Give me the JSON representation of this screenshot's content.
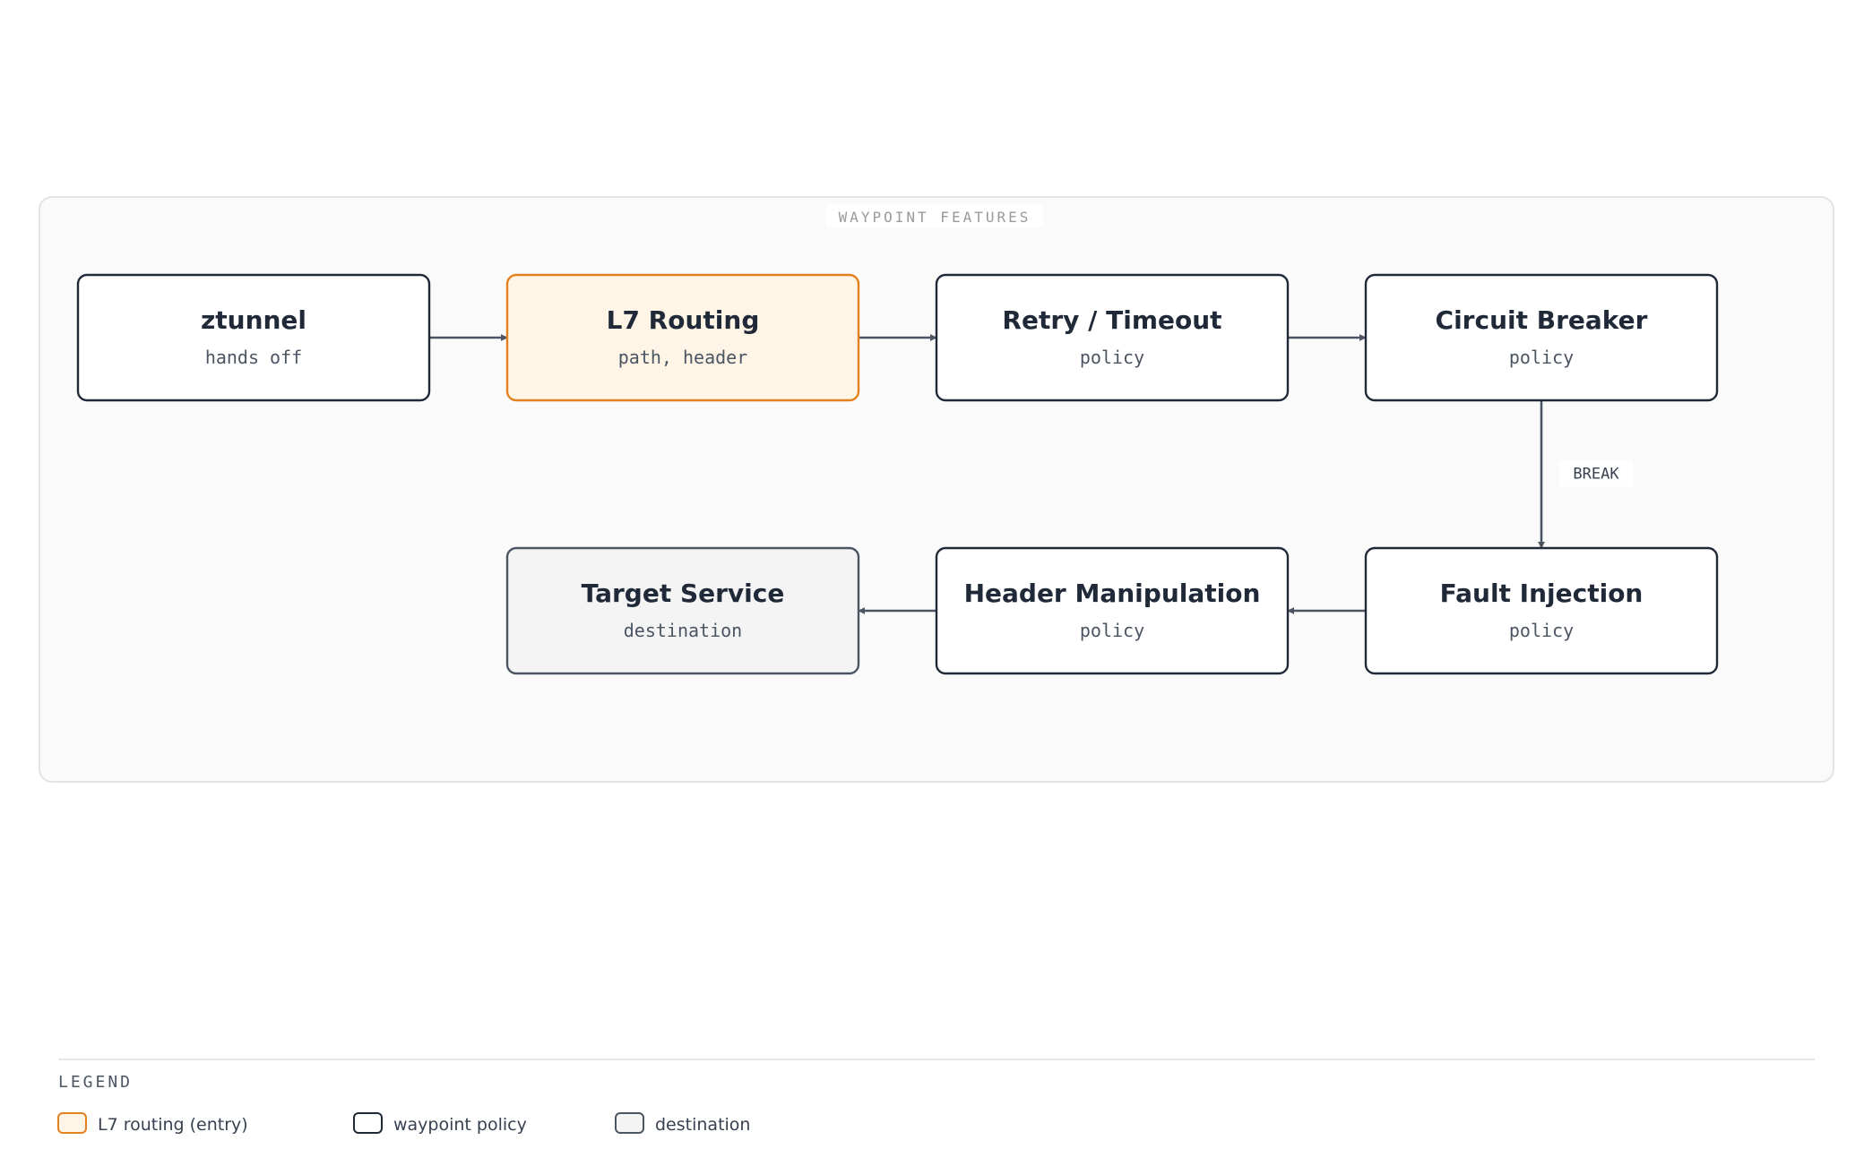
{
  "group": {
    "label": "WAYPOINT FEATURES"
  },
  "styles": {
    "entry": {
      "fill": "#fef5e6",
      "stroke": "#e5801f"
    },
    "policy": {
      "fill": "#ffffff",
      "stroke": "#1f2937"
    },
    "destination": {
      "fill": "#f4f4f5",
      "stroke": "#4b5563"
    }
  },
  "nodes": [
    {
      "id": "ztunnel",
      "title": "ztunnel",
      "subtitle": "hands off",
      "style": "policy"
    },
    {
      "id": "l7-routing",
      "title": "L7 Routing",
      "subtitle": "path, header",
      "style": "entry"
    },
    {
      "id": "retry-timeout",
      "title": "Retry / Timeout",
      "subtitle": "policy",
      "style": "policy"
    },
    {
      "id": "circuit-breaker",
      "title": "Circuit Breaker",
      "subtitle": "policy",
      "style": "policy"
    },
    {
      "id": "fault-injection",
      "title": "Fault Injection",
      "subtitle": "policy",
      "style": "policy"
    },
    {
      "id": "header-manipulation",
      "title": "Header Manipulation",
      "subtitle": "policy",
      "style": "policy"
    },
    {
      "id": "target-service",
      "title": "Target Service",
      "subtitle": "destination",
      "style": "destination"
    }
  ],
  "edges": [
    {
      "from": "ztunnel",
      "to": "l7-routing",
      "label": ""
    },
    {
      "from": "l7-routing",
      "to": "retry-timeout",
      "label": ""
    },
    {
      "from": "retry-timeout",
      "to": "circuit-breaker",
      "label": ""
    },
    {
      "from": "circuit-breaker",
      "to": "fault-injection",
      "label": "BREAK"
    },
    {
      "from": "fault-injection",
      "to": "header-manipulation",
      "label": ""
    },
    {
      "from": "header-manipulation",
      "to": "target-service",
      "label": ""
    }
  ],
  "legend": {
    "title": "LEGEND",
    "items": [
      {
        "label": "L7 routing (entry)",
        "style": "entry"
      },
      {
        "label": "waypoint policy",
        "style": "policy"
      },
      {
        "label": "destination",
        "style": "destination"
      }
    ]
  }
}
